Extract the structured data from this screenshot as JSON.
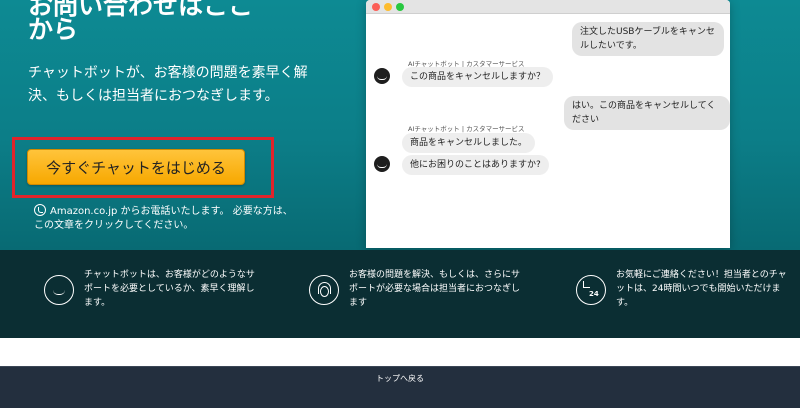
{
  "hero": {
    "title_line1": "お問い合わせはここ",
    "title_line2": "から",
    "subtitle": "チャットボットが、お客様の問題を素早く解決、もしくは担当者におつなぎします。",
    "cta_label": "今すぐチャットをはじめる",
    "phone_note": "Amazon.co.jp からお電話いたします。 必要な方は、この文章をクリックしてください。"
  },
  "chat": {
    "messages": [
      {
        "role": "user",
        "text": "注文したUSBケーブルをキャンセルしたいです。"
      },
      {
        "role": "bot",
        "label": "AIチャットボット | カスタマーサービス",
        "text": "この商品をキャンセルしますか？"
      },
      {
        "role": "user",
        "text": "はい。この商品をキャンセルしてください"
      },
      {
        "role": "bot",
        "label": "AIチャットボット | カスタマーサービス",
        "text": "商品をキャンセルしました。"
      },
      {
        "role": "bot",
        "text": "他にお困りのことはありますか?"
      }
    ]
  },
  "features": [
    {
      "icon": "smile-icon",
      "text": "チャットボットは、お客様がどのようなサポートを必要としているか、素早く理解します。"
    },
    {
      "icon": "headset-icon",
      "text": "お客様の問題を解決、もしくは、さらにサポートが必要な場合は担当者におつなぎします"
    },
    {
      "icon": "clock-24-icon",
      "clock_label": "24",
      "text": "お気軽にご連絡ください！担当者とのチャットは、24時間いつでも開始いただけます。"
    }
  ],
  "footer": {
    "back_to_top": "トップへ戻る"
  },
  "colors": {
    "hero_bg": "#0c7e88",
    "cta_bg": "#f7a800",
    "highlight_border": "#e0242b",
    "features_bg": "#0b2e33",
    "footer_bg": "#232f3e"
  }
}
